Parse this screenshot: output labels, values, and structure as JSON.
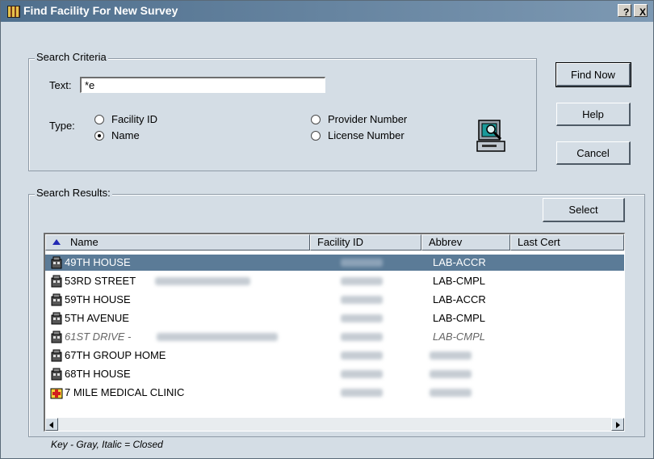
{
  "window": {
    "title": "Find Facility For New Survey",
    "help_button": "?",
    "close_button": "X"
  },
  "search_criteria": {
    "legend": "Search Criteria",
    "text_label": "Text:",
    "text_value": "*e",
    "type_label": "Type:",
    "types": [
      {
        "label": "Facility ID",
        "selected": false
      },
      {
        "label": "Name",
        "selected": true
      },
      {
        "label": "Provider Number",
        "selected": false
      },
      {
        "label": "License Number",
        "selected": false
      }
    ]
  },
  "buttons": {
    "find_now": "Find Now",
    "help": "Help",
    "cancel": "Cancel",
    "select": "Select"
  },
  "results": {
    "legend": "Search Results:",
    "columns": [
      "Name",
      "Facility ID",
      "Abbrev",
      "Last Cert"
    ],
    "rows": [
      {
        "name": "49TH HOUSE",
        "abbrev": "LAB-ACCR",
        "selected": true,
        "closed": false,
        "icon": "building-icon"
      },
      {
        "name": "53RD STREET",
        "abbrev": "LAB-CMPL",
        "selected": false,
        "closed": false,
        "icon": "building-icon"
      },
      {
        "name": "59TH HOUSE",
        "abbrev": "LAB-ACCR",
        "selected": false,
        "closed": false,
        "icon": "building-icon"
      },
      {
        "name": "5TH AVENUE",
        "abbrev": "LAB-CMPL",
        "selected": false,
        "closed": false,
        "icon": "building-icon"
      },
      {
        "name": "61ST DRIVE -",
        "abbrev": "LAB-CMPL",
        "selected": false,
        "closed": true,
        "icon": "building-icon"
      },
      {
        "name": "67TH GROUP HOME",
        "abbrev": "",
        "selected": false,
        "closed": false,
        "icon": "building-icon"
      },
      {
        "name": "68TH HOUSE",
        "abbrev": "",
        "selected": false,
        "closed": false,
        "icon": "building-icon"
      },
      {
        "name": "7 MILE MEDICAL CLINIC",
        "abbrev": "",
        "selected": false,
        "closed": false,
        "icon": "medical-clinic-icon"
      }
    ]
  },
  "footer": {
    "key_text": "Key - Gray, Italic = Closed"
  },
  "colors": {
    "titlebar": "#4f6f8d",
    "dialog_bg": "#d4dde5",
    "selection": "#5b7b97",
    "sort_arrow": "#2229b4"
  }
}
